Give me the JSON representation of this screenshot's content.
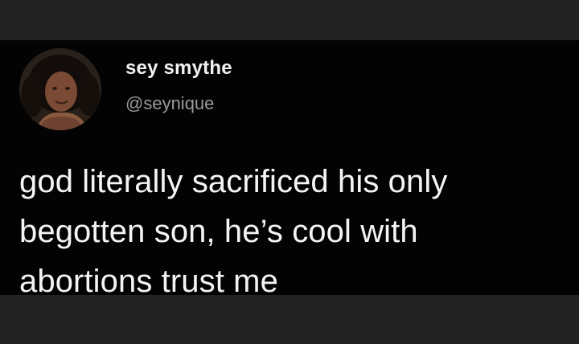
{
  "tweet": {
    "author": {
      "display_name": "sey smythe",
      "handle": "@seynique",
      "avatar_icon": "user-avatar-photo"
    },
    "text": "god literally sacrificed his only\nbegotten son, he’s cool with\nabortions trust me"
  },
  "colors": {
    "background": "#030303",
    "frame": "#232323",
    "name_text": "#f2f2f2",
    "handle_text": "#9a9a9a",
    "body_text": "#f4f4f4"
  }
}
